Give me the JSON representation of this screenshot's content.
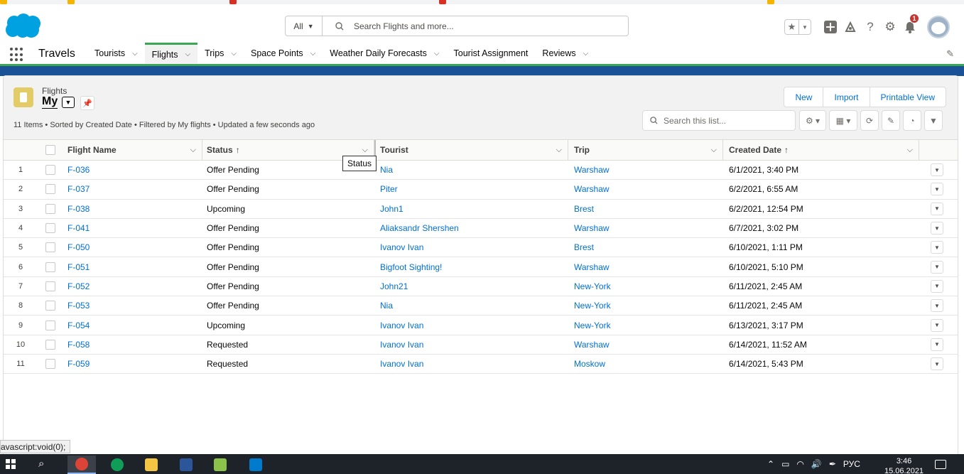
{
  "header": {
    "search_scope": "All",
    "search_placeholder": "Search Flights and more...",
    "notification_count": "1"
  },
  "nav": {
    "app_name": "Travels",
    "items": [
      {
        "label": "Tourists",
        "has_menu": true,
        "active": false
      },
      {
        "label": "Flights",
        "has_menu": true,
        "active": true
      },
      {
        "label": "Trips",
        "has_menu": true,
        "active": false
      },
      {
        "label": "Space Points",
        "has_menu": true,
        "active": false
      },
      {
        "label": "Weather Daily Forecasts",
        "has_menu": true,
        "active": false
      },
      {
        "label": "Tourist Assignment",
        "has_menu": false,
        "active": false
      },
      {
        "label": "Reviews",
        "has_menu": true,
        "active": false
      }
    ]
  },
  "list": {
    "object_label": "Flights",
    "view_name": "My",
    "meta": "11 Items • Sorted by Created Date • Filtered by My flights • Updated a few seconds ago",
    "buttons": {
      "new": "New",
      "import": "Import",
      "printable": "Printable View"
    },
    "search_placeholder": "Search this list...",
    "columns": {
      "name": "Flight Name",
      "status": "Status",
      "tourist": "Tourist",
      "trip": "Trip",
      "created": "Created Date"
    },
    "tooltip": "Status",
    "rows": [
      {
        "num": "1",
        "name": "F-036",
        "status": "Offer Pending",
        "tourist": "Nia",
        "trip": "Warshaw",
        "created": "6/1/2021, 3:40 PM"
      },
      {
        "num": "2",
        "name": "F-037",
        "status": "Offer Pending",
        "tourist": "Piter",
        "trip": "Warshaw",
        "created": "6/2/2021, 6:55 AM"
      },
      {
        "num": "3",
        "name": "F-038",
        "status": "Upcoming",
        "tourist": "John1",
        "trip": "Brest",
        "created": "6/2/2021, 12:54 PM"
      },
      {
        "num": "4",
        "name": "F-041",
        "status": "Offer Pending",
        "tourist": "Aliaksandr Shershen",
        "trip": "Warshaw",
        "created": "6/7/2021, 3:02 PM"
      },
      {
        "num": "5",
        "name": "F-050",
        "status": "Offer Pending",
        "tourist": "Ivanov Ivan",
        "trip": "Brest",
        "created": "6/10/2021, 1:11 PM"
      },
      {
        "num": "6",
        "name": "F-051",
        "status": "Offer Pending",
        "tourist": "Bigfoot Sighting!",
        "trip": "Warshaw",
        "created": "6/10/2021, 5:10 PM"
      },
      {
        "num": "7",
        "name": "F-052",
        "status": "Offer Pending",
        "tourist": "John21",
        "trip": "New-York",
        "created": "6/11/2021, 2:45 AM"
      },
      {
        "num": "8",
        "name": "F-053",
        "status": "Offer Pending",
        "tourist": "Nia",
        "trip": "New-York",
        "created": "6/11/2021, 2:45 AM"
      },
      {
        "num": "9",
        "name": "F-054",
        "status": "Upcoming",
        "tourist": "Ivanov Ivan",
        "trip": "New-York",
        "created": "6/13/2021, 3:17 PM"
      },
      {
        "num": "10",
        "name": "F-058",
        "status": "Requested",
        "tourist": "Ivanov Ivan",
        "trip": "Warshaw",
        "created": "6/14/2021, 11:52 AM"
      },
      {
        "num": "11",
        "name": "F-059",
        "status": "Requested",
        "tourist": "Ivanov Ivan",
        "trip": "Moskow",
        "created": "6/14/2021, 5:43 PM"
      }
    ]
  },
  "status_bar": {
    "url": "avascript:void(0);"
  },
  "taskbar": {
    "lang": "РУС",
    "time": "3:46",
    "date": "15.06.2021"
  },
  "colors": {
    "brand": "#00a1e0",
    "link": "#0070d2",
    "nav_active": "#3ba755",
    "object_icon": "#e3cc68"
  }
}
